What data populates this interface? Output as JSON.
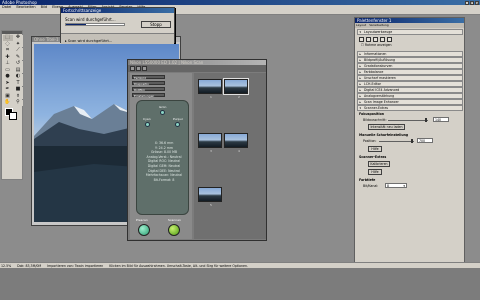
{
  "app": {
    "title": "Adobe Photoshop",
    "menu": [
      "Datei",
      "Bearbeiten",
      "Bild",
      "Ebene",
      "Auswahl",
      "Filter",
      "Ansicht",
      "Fenster",
      "Hilfe"
    ]
  },
  "document": {
    "title": "Ohne Titel-1"
  },
  "progress": {
    "title": "Fortschrittsanzeige",
    "message": "Scan wird durchgeführt...",
    "button": "Stopp",
    "sub_message": "Scan wird durchgeführt...",
    "fill_fraction": 0.35
  },
  "nikon": {
    "title": "Nikon LS-5000 / SUPER COOLSCAN 5000 ED / Nikon Scan 3.1.2",
    "title_short": "Nikon LS50000 ED 1.02 | Nikon Scan",
    "dropdowns": [
      "Farbbild",
      "Diapositiv",
      "Rollfilm",
      "Einstellungen"
    ],
    "channels": [
      "Rot",
      "Grün",
      "Blau"
    ],
    "channels2": [
      "Cyan",
      "Gelb",
      "Purpur"
    ],
    "info_lines": [
      "X: 36.6 mm",
      "Y: 24.2 mm",
      "Grösse: 8.00 MB",
      "Analog-Verst.: Neutral",
      "Digital ROC: Neutral",
      "Digital GEM: Neutral",
      "Digital DEE: Neutral",
      "Mehrfachscan: Neutral",
      "Bit-Format: 8"
    ],
    "preview_label": "Prescan",
    "scan_label": "Scannen",
    "thumb_numbers": [
      "1",
      "2",
      "3",
      "4",
      "5"
    ]
  },
  "palette": {
    "title": "Palettenfenster 1",
    "tabs": [
      "Layout",
      "Verarbeitung"
    ],
    "layout_label": "Layoutwerkzeuge",
    "crop_label": "Rahme anzeigen",
    "sections": [
      "Informationen",
      "Bildprofil/Auflösung",
      "Gradationskurven",
      "Farbbalance",
      "Unscharf maskieren",
      "LCH-Editor",
      "Digital ICE4 Advanced",
      "Analogverstärkung",
      "Scan Image Enhancer",
      "Scanner-Extras"
    ],
    "focus_label": "Fokusposition",
    "focus_sub": "Bildausschnitt:",
    "focus_value": "140",
    "focus_button": "Intensität neu laden",
    "manual_label": "Manuelle Scharfeinstellung",
    "position_label": "Position:",
    "position_value": "700",
    "help_button": "Hilfe",
    "scanner_extras_label": "Scanner-Extras",
    "calibrate_button": "Kalibrieren",
    "help_button2": "Hilfe",
    "bits_label": "Farbtiefe",
    "bits_sub": "Bit/Kanal:",
    "bits_value": "8"
  },
  "status": {
    "zoom": "12.5%",
    "doc_size": "Dok: 83,3M/0M",
    "hint": "Importieren von: Twain importieren",
    "tip": "Klicken im Bild für Auswahlrahmen. Umschalt-Taste, Alt- und Strg für weitere Optionen."
  }
}
